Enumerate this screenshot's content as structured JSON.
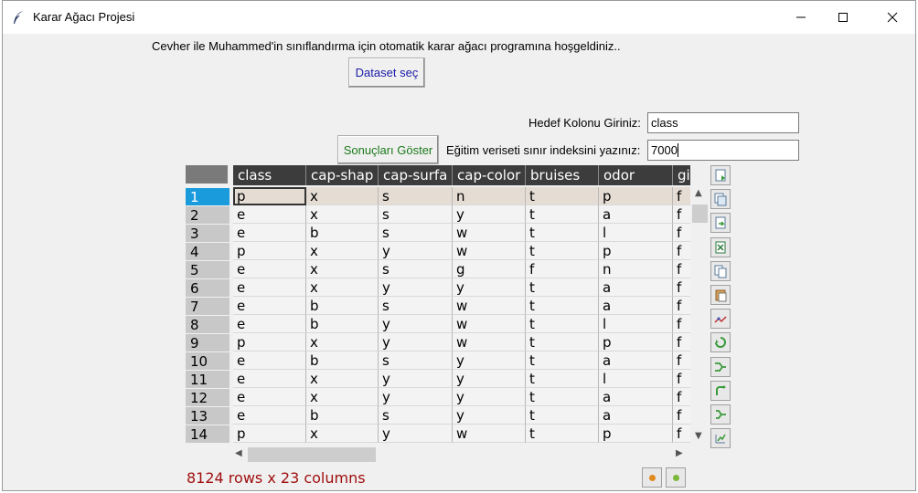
{
  "window": {
    "title": "Karar Ağacı Projesi"
  },
  "header": {
    "welcome": "Cevher ile Muhammed'in sınıflandırma için otomatik karar ağacı programına hoşgeldiniz..",
    "dataset_button": "Dataset seç",
    "results_button": "Sonuçları Göster"
  },
  "form": {
    "target_label": "Hedef Kolonu Giriniz:",
    "target_value": "class",
    "index_label": "Eğitim veriseti sınır indeksini yazınız:",
    "index_value": "7000"
  },
  "table": {
    "columns": [
      "class",
      "cap-shap",
      "cap-surfa",
      "cap-color",
      "bruises",
      "odor",
      "gi"
    ],
    "row_numbers": [
      "1",
      "2",
      "3",
      "4",
      "5",
      "6",
      "7",
      "8",
      "9",
      "10",
      "11",
      "12",
      "13",
      "14"
    ],
    "rows": [
      [
        "p",
        "x",
        "s",
        "n",
        "t",
        "p",
        "f"
      ],
      [
        "e",
        "x",
        "s",
        "y",
        "t",
        "a",
        "f"
      ],
      [
        "e",
        "b",
        "s",
        "w",
        "t",
        "l",
        "f"
      ],
      [
        "p",
        "x",
        "y",
        "w",
        "t",
        "p",
        "f"
      ],
      [
        "e",
        "x",
        "s",
        "g",
        "f",
        "n",
        "f"
      ],
      [
        "e",
        "x",
        "y",
        "y",
        "t",
        "a",
        "f"
      ],
      [
        "e",
        "b",
        "s",
        "w",
        "t",
        "a",
        "f"
      ],
      [
        "e",
        "b",
        "y",
        "w",
        "t",
        "l",
        "f"
      ],
      [
        "p",
        "x",
        "y",
        "w",
        "t",
        "p",
        "f"
      ],
      [
        "e",
        "b",
        "s",
        "y",
        "t",
        "a",
        "f"
      ],
      [
        "e",
        "x",
        "y",
        "y",
        "t",
        "l",
        "f"
      ],
      [
        "e",
        "x",
        "y",
        "y",
        "t",
        "a",
        "f"
      ],
      [
        "e",
        "b",
        "s",
        "y",
        "t",
        "a",
        "f"
      ],
      [
        "p",
        "x",
        "y",
        "w",
        "t",
        "p",
        "f"
      ]
    ],
    "selected_row": "1",
    "status": "8124 rows x 23 columns"
  },
  "toolbar": {
    "icons": [
      "save-icon",
      "copy-table-icon",
      "import-icon",
      "excel-icon",
      "copy-icon",
      "paste-icon",
      "plot-icon",
      "transform-icon",
      "merge-icon",
      "pivot-icon",
      "split-icon",
      "query-icon"
    ]
  },
  "colors": {
    "accent_selected": "#1a9bdc",
    "header_bg": "#3c3c3c",
    "status_text": "#a01010",
    "dataset_btn_text": "#1a1aa8",
    "results_btn_text": "#1b7a1b"
  }
}
